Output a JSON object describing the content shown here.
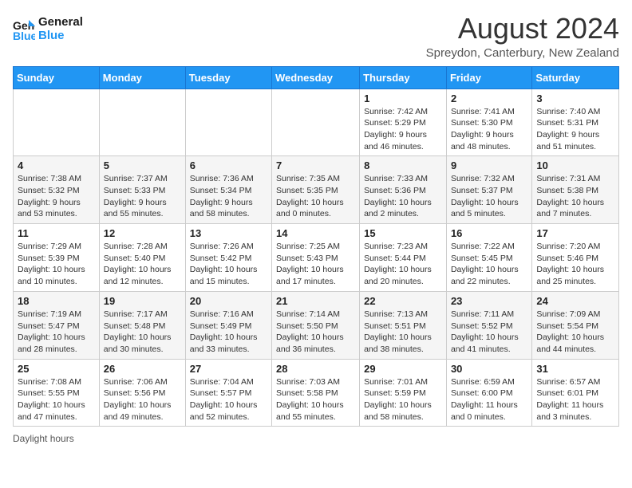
{
  "header": {
    "logo_line1": "General",
    "logo_line2": "Blue",
    "title": "August 2024",
    "subtitle": "Spreydon, Canterbury, New Zealand"
  },
  "days_of_week": [
    "Sunday",
    "Monday",
    "Tuesday",
    "Wednesday",
    "Thursday",
    "Friday",
    "Saturday"
  ],
  "weeks": [
    [
      {
        "day": "",
        "info": ""
      },
      {
        "day": "",
        "info": ""
      },
      {
        "day": "",
        "info": ""
      },
      {
        "day": "",
        "info": ""
      },
      {
        "day": "1",
        "info": "Sunrise: 7:42 AM\nSunset: 5:29 PM\nDaylight: 9 hours and 46 minutes."
      },
      {
        "day": "2",
        "info": "Sunrise: 7:41 AM\nSunset: 5:30 PM\nDaylight: 9 hours and 48 minutes."
      },
      {
        "day": "3",
        "info": "Sunrise: 7:40 AM\nSunset: 5:31 PM\nDaylight: 9 hours and 51 minutes."
      }
    ],
    [
      {
        "day": "4",
        "info": "Sunrise: 7:38 AM\nSunset: 5:32 PM\nDaylight: 9 hours and 53 minutes."
      },
      {
        "day": "5",
        "info": "Sunrise: 7:37 AM\nSunset: 5:33 PM\nDaylight: 9 hours and 55 minutes."
      },
      {
        "day": "6",
        "info": "Sunrise: 7:36 AM\nSunset: 5:34 PM\nDaylight: 9 hours and 58 minutes."
      },
      {
        "day": "7",
        "info": "Sunrise: 7:35 AM\nSunset: 5:35 PM\nDaylight: 10 hours and 0 minutes."
      },
      {
        "day": "8",
        "info": "Sunrise: 7:33 AM\nSunset: 5:36 PM\nDaylight: 10 hours and 2 minutes."
      },
      {
        "day": "9",
        "info": "Sunrise: 7:32 AM\nSunset: 5:37 PM\nDaylight: 10 hours and 5 minutes."
      },
      {
        "day": "10",
        "info": "Sunrise: 7:31 AM\nSunset: 5:38 PM\nDaylight: 10 hours and 7 minutes."
      }
    ],
    [
      {
        "day": "11",
        "info": "Sunrise: 7:29 AM\nSunset: 5:39 PM\nDaylight: 10 hours and 10 minutes."
      },
      {
        "day": "12",
        "info": "Sunrise: 7:28 AM\nSunset: 5:40 PM\nDaylight: 10 hours and 12 minutes."
      },
      {
        "day": "13",
        "info": "Sunrise: 7:26 AM\nSunset: 5:42 PM\nDaylight: 10 hours and 15 minutes."
      },
      {
        "day": "14",
        "info": "Sunrise: 7:25 AM\nSunset: 5:43 PM\nDaylight: 10 hours and 17 minutes."
      },
      {
        "day": "15",
        "info": "Sunrise: 7:23 AM\nSunset: 5:44 PM\nDaylight: 10 hours and 20 minutes."
      },
      {
        "day": "16",
        "info": "Sunrise: 7:22 AM\nSunset: 5:45 PM\nDaylight: 10 hours and 22 minutes."
      },
      {
        "day": "17",
        "info": "Sunrise: 7:20 AM\nSunset: 5:46 PM\nDaylight: 10 hours and 25 minutes."
      }
    ],
    [
      {
        "day": "18",
        "info": "Sunrise: 7:19 AM\nSunset: 5:47 PM\nDaylight: 10 hours and 28 minutes."
      },
      {
        "day": "19",
        "info": "Sunrise: 7:17 AM\nSunset: 5:48 PM\nDaylight: 10 hours and 30 minutes."
      },
      {
        "day": "20",
        "info": "Sunrise: 7:16 AM\nSunset: 5:49 PM\nDaylight: 10 hours and 33 minutes."
      },
      {
        "day": "21",
        "info": "Sunrise: 7:14 AM\nSunset: 5:50 PM\nDaylight: 10 hours and 36 minutes."
      },
      {
        "day": "22",
        "info": "Sunrise: 7:13 AM\nSunset: 5:51 PM\nDaylight: 10 hours and 38 minutes."
      },
      {
        "day": "23",
        "info": "Sunrise: 7:11 AM\nSunset: 5:52 PM\nDaylight: 10 hours and 41 minutes."
      },
      {
        "day": "24",
        "info": "Sunrise: 7:09 AM\nSunset: 5:54 PM\nDaylight: 10 hours and 44 minutes."
      }
    ],
    [
      {
        "day": "25",
        "info": "Sunrise: 7:08 AM\nSunset: 5:55 PM\nDaylight: 10 hours and 47 minutes."
      },
      {
        "day": "26",
        "info": "Sunrise: 7:06 AM\nSunset: 5:56 PM\nDaylight: 10 hours and 49 minutes."
      },
      {
        "day": "27",
        "info": "Sunrise: 7:04 AM\nSunset: 5:57 PM\nDaylight: 10 hours and 52 minutes."
      },
      {
        "day": "28",
        "info": "Sunrise: 7:03 AM\nSunset: 5:58 PM\nDaylight: 10 hours and 55 minutes."
      },
      {
        "day": "29",
        "info": "Sunrise: 7:01 AM\nSunset: 5:59 PM\nDaylight: 10 hours and 58 minutes."
      },
      {
        "day": "30",
        "info": "Sunrise: 6:59 AM\nSunset: 6:00 PM\nDaylight: 11 hours and 0 minutes."
      },
      {
        "day": "31",
        "info": "Sunrise: 6:57 AM\nSunset: 6:01 PM\nDaylight: 11 hours and 3 minutes."
      }
    ]
  ],
  "footer": {
    "daylight_label": "Daylight hours"
  }
}
